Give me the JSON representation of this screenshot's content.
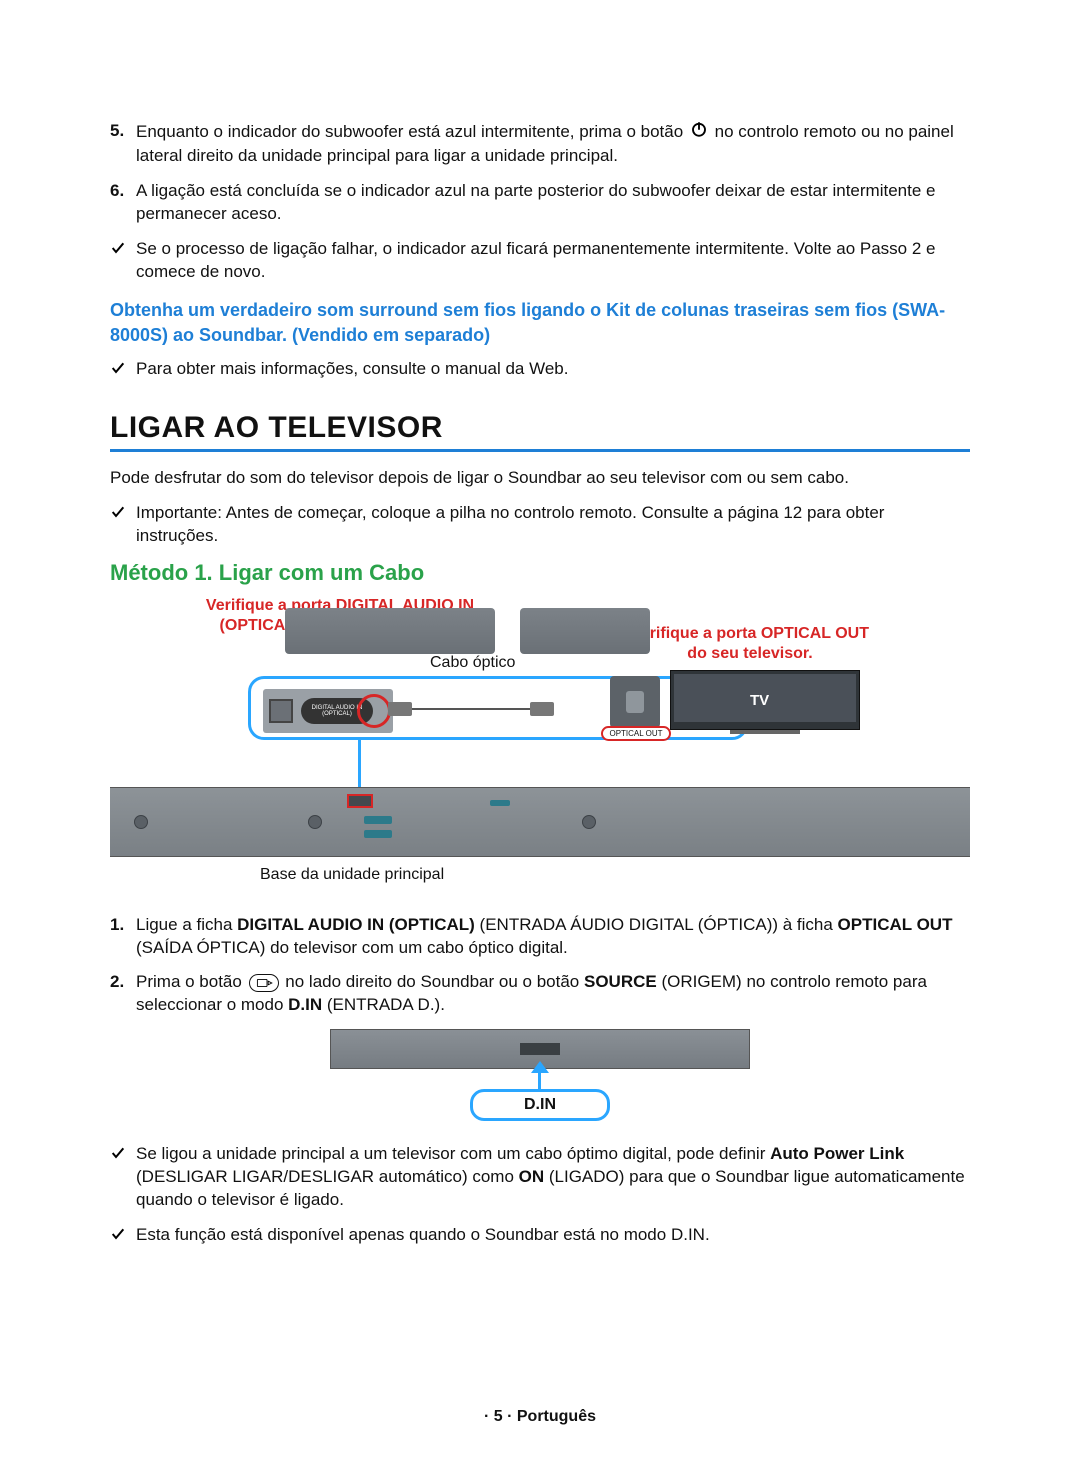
{
  "list5_num": "5.",
  "list5_a": "Enquanto o indicador do subwoofer está azul intermitente, prima o botão ",
  "list5_b": " no controlo remoto ou no painel lateral direito da unidade principal para ligar a unidade principal.",
  "list6_num": "6.",
  "list6": "A ligação está concluída se o indicador azul na parte posterior do subwoofer deixar de estar intermitente e permanecer aceso.",
  "check1": "Se o processo de ligação falhar, o indicador azul ficará permanentemente intermitente. Volte ao Passo 2 e comece de novo.",
  "highlight": "Obtenha um verdadeiro som surround sem fios ligando o Kit de colunas traseiras sem fios (SWA-8000S) ao Soundbar. (Vendido em separado)",
  "check2": "Para obter mais informações, consulte o manual da Web.",
  "h1": "LIGAR AO TELEVISOR",
  "intro": "Pode desfrutar do som do televisor depois de ligar o Soundbar ao seu televisor com ou sem cabo.",
  "check3": "Importante: Antes de começar, coloque a pilha no controlo remoto. Consulte a página 12 para obter instruções.",
  "method1": "Método 1. Ligar com um Cabo",
  "d1_left_label": "Verifique a porta DIGITAL AUDIO IN (OPTICAL) da unidade principal",
  "d1_right_label": "Verifique a porta OPTICAL OUT do seu televisor.",
  "d1_cable": "Cabo óptico",
  "d1_port_text": "DIGITAL AUDIO IN (OPTICAL)",
  "d1_tv": "TV",
  "d1_optical_out": "OPTICAL OUT",
  "d1_bottom": "Base da unidade principal",
  "step1_num": "1.",
  "step1_a": "Ligue a ficha ",
  "step1_b": "DIGITAL AUDIO IN (OPTICAL)",
  "step1_c": " (ENTRADA ÁUDIO DIGITAL (ÓPTICA)) à ficha ",
  "step1_d": "OPTICAL OUT",
  "step1_e": " (SAÍDA ÓPTICA) do televisor com um cabo óptico digital.",
  "step2_num": "2.",
  "step2_a": "Prima o botão ",
  "step2_b": " no lado direito do Soundbar ou o botão ",
  "step2_c": "SOURCE",
  "step2_d": " (ORIGEM) no controlo remoto para seleccionar o modo ",
  "step2_e": "D.IN",
  "step2_f": " (ENTRADA D.).",
  "din_label": "D.IN",
  "check4_a": "Se ligou a unidade principal a um televisor com um cabo óptimo digital, pode definir ",
  "check4_b": "Auto Power Link",
  "check4_c": " (DESLIGAR LIGAR/DESLIGAR automático) como ",
  "check4_d": "ON",
  "check4_e": " (LIGADO) para que o Soundbar ligue automaticamente quando o televisor é ligado.",
  "check5": "Esta função está disponível apenas quando o Soundbar está no modo D.IN.",
  "footer": "· 5 · Português"
}
